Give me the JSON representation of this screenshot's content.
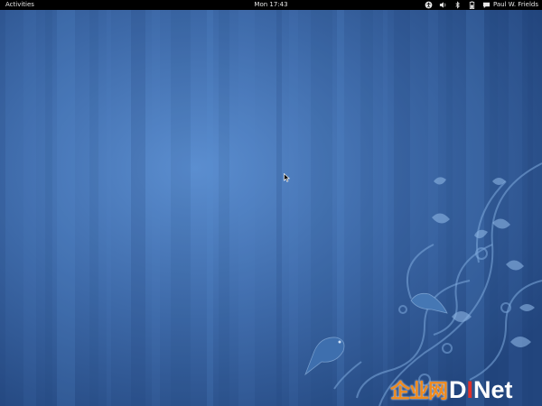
{
  "topbar": {
    "activities_label": "Activities",
    "clock": "Mon 17:43",
    "user_name": "Paul W. Frields",
    "tray_icons": [
      "accessibility-icon",
      "volume-icon",
      "bluetooth-icon",
      "battery-icon",
      "chat-bubble-icon"
    ]
  },
  "desktop": {
    "wallpaper_colors": {
      "base": "#2d5590",
      "light": "#5b8ed0",
      "dark": "#20437a"
    }
  },
  "watermark": {
    "cn_text": "企业网",
    "brand_d": "D",
    "brand_i": "I",
    "brand_net": "Net"
  }
}
